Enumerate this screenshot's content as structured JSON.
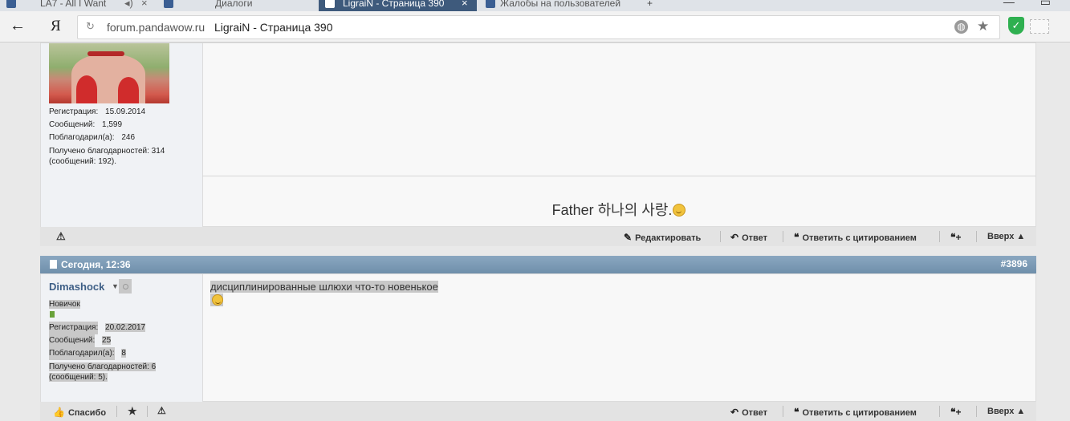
{
  "browser": {
    "tabs": [
      {
        "label": "LA7 - All I Want"
      },
      {
        "label": "Диалоги"
      },
      {
        "label": "LigraiN - Страница 390"
      },
      {
        "label": "Жалобы на пользователей"
      }
    ],
    "address": {
      "url": "forum.pandawow.ru",
      "title": "LigraiN - Страница 390",
      "ya": "Я"
    }
  },
  "post1": {
    "user": {
      "stats": [
        {
          "label": "Регистрация:",
          "value": "15.09.2014"
        },
        {
          "label": "Сообщений:",
          "value": "1,599"
        },
        {
          "label": "Поблагодарил(а):",
          "value": "246"
        }
      ],
      "thanks_line1": "Получено благодарностей: 314",
      "thanks_line2": "(сообщений: 192)."
    },
    "signature": "Father 하나의 사랑.",
    "actions": {
      "edit": "Редактировать",
      "reply": "Ответ",
      "quote": "Ответить с цитированием",
      "top": "Вверх ▲"
    }
  },
  "post2": {
    "date": "Сегодня, 12:36",
    "number": "#3896",
    "user": {
      "name": "Dimashock",
      "rank": "Новичок",
      "stats": [
        {
          "label": "Регистрация:",
          "value": "20.02.2017"
        },
        {
          "label": "Сообщений:",
          "value": "25"
        },
        {
          "label": "Поблагодарил(а):",
          "value": "8"
        }
      ],
      "thanks_line1": "Получено благодарностей: 6",
      "thanks_line2": "(сообщений: 5)."
    },
    "message": "дисциплинированные шлюхи что-то новенькое",
    "actions": {
      "thanks": "Спасибо",
      "reply": "Ответ",
      "quote": "Ответить с цитированием",
      "top": "Вверх ▲"
    }
  }
}
